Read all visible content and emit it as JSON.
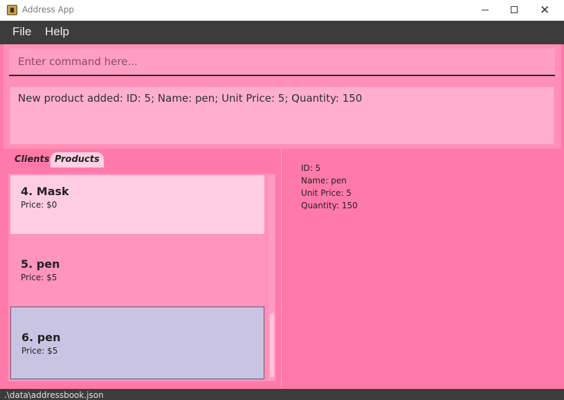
{
  "window": {
    "title": "Address App",
    "minimize_glyph": "",
    "close_glyph": "✕"
  },
  "menu": {
    "file": "File",
    "help": "Help"
  },
  "command": {
    "placeholder": "Enter command here..."
  },
  "result": {
    "message": "New product added: ID: 5; Name: pen; Unit Price: 5; Quantity: 150"
  },
  "tabs": {
    "clients": "Clients",
    "products": "Products"
  },
  "products": [
    {
      "title": "4.  Mask",
      "price": "Price: $0"
    },
    {
      "title": "5.  pen",
      "price": "Price: $5"
    },
    {
      "title": "6.  pen",
      "price": "Price: $5"
    }
  ],
  "detail": {
    "id": "ID: 5",
    "name": "Name: pen",
    "unit_price": "Unit Price: 5",
    "quantity": "Quantity: 150"
  },
  "status": {
    "path": ".\\data\\addressbook.json"
  }
}
